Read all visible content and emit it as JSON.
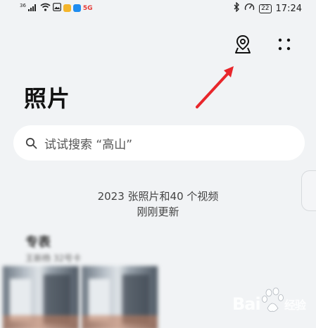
{
  "status_bar": {
    "network_label": "36",
    "signal_icon": "signal-icon",
    "wifi_icon": "wifi-icon",
    "app_icons": [
      "gallery-notification-icon",
      "yellow-app-icon",
      "blue-app-icon",
      "5g-app-icon"
    ],
    "fiveg_label": "5G",
    "bluetooth_icon": "bluetooth-icon",
    "speed_icon": "speedometer-icon",
    "battery": "22",
    "time": "17:24"
  },
  "header": {
    "location_icon": "location-pin-icon",
    "more_icon": "more-icon"
  },
  "page": {
    "title": "照片"
  },
  "search": {
    "icon": "search-icon",
    "placeholder": "试试搜索 “高山”"
  },
  "summary": {
    "counts": "2023 张照片和40 个视频",
    "updated": "刚刚更新"
  },
  "album": {
    "title": "专表",
    "subtitle": "王新杨 32号卡"
  },
  "annotation": {
    "arrow_color": "#e8262b"
  },
  "watermark": {
    "text": "Bai",
    "suffix": "经验"
  },
  "colors": {
    "background": "#f1f3f5",
    "search_bg": "#ffffff",
    "text_primary": "#111111",
    "text_secondary": "#444444"
  }
}
